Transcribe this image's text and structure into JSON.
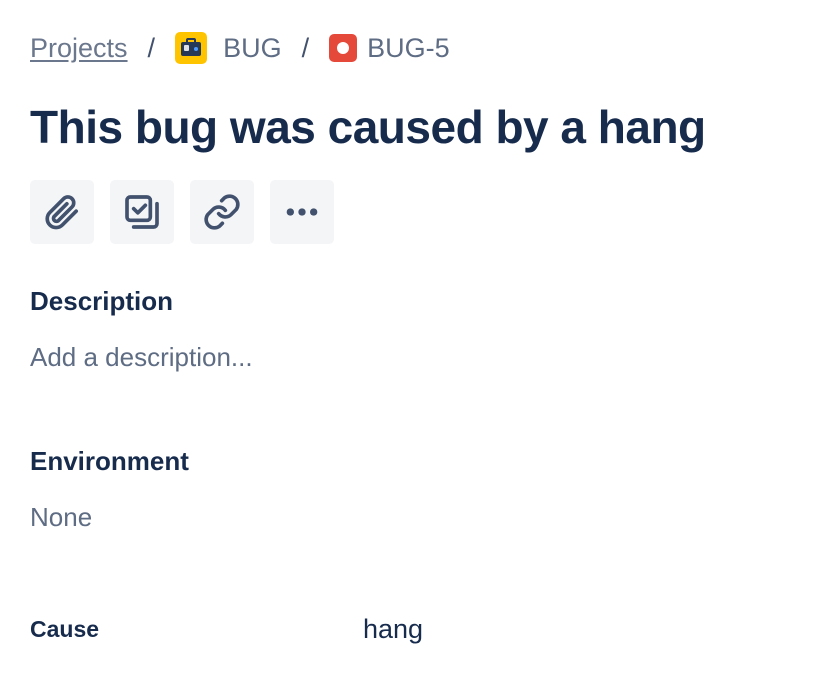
{
  "breadcrumb": {
    "projects_label": "Projects",
    "separator": "/",
    "project_name": "BUG",
    "project_avatar_icon": "briefcase-icon",
    "issue_type_icon": "bug-icon",
    "issue_key": "BUG-5"
  },
  "issue": {
    "title": "This bug was caused by a hang"
  },
  "toolbar": {
    "buttons": [
      {
        "name": "attach",
        "icon": "paperclip-icon"
      },
      {
        "name": "create-subtask",
        "icon": "subtask-icon"
      },
      {
        "name": "link-issue",
        "icon": "link-icon"
      },
      {
        "name": "more-actions",
        "icon": "more-horizontal-icon"
      }
    ]
  },
  "description": {
    "heading": "Description",
    "placeholder": "Add a description..."
  },
  "environment": {
    "heading": "Environment",
    "value": "None"
  },
  "fields": {
    "cause": {
      "label": "Cause",
      "value": "hang"
    }
  },
  "colors": {
    "text_primary": "#172b4d",
    "text_subtle": "#5e6c84",
    "project_avatar": "#ffc400",
    "bug_icon": "#e5493a",
    "button_bg": "#f4f5f7"
  }
}
